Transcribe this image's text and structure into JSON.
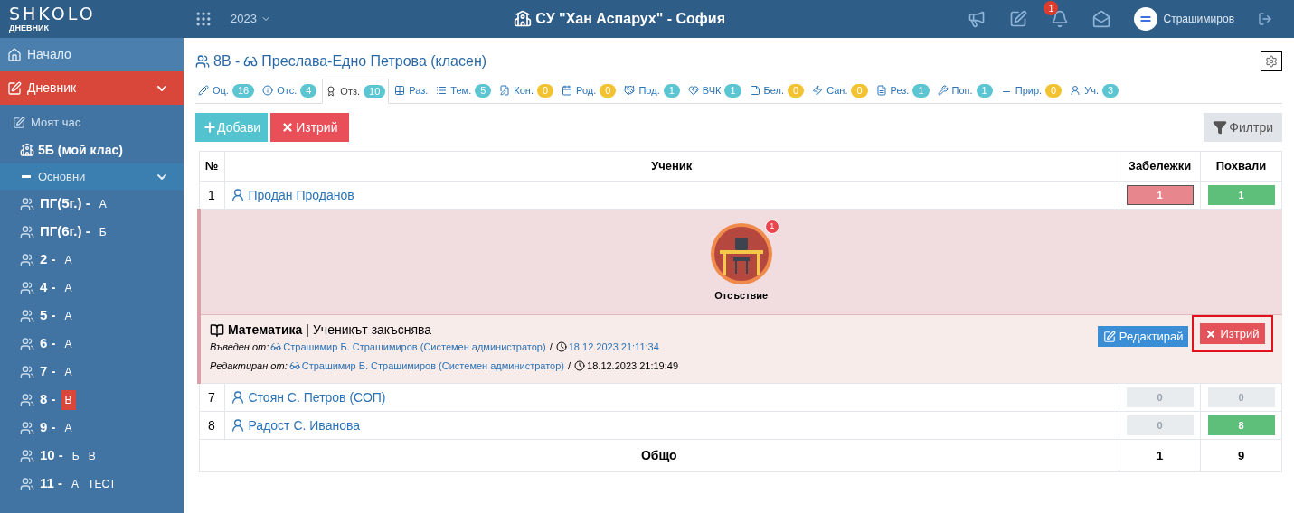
{
  "header": {
    "logo": "SHKOLO",
    "logo_sub": "ДНЕВНИК",
    "year": "2023",
    "school": "СУ \"Хан Аспарух\" - София",
    "notifications": "1",
    "user": "Страшимиров"
  },
  "sidebar": {
    "items": [
      {
        "kind": "main",
        "label": "Начало",
        "selected": false
      },
      {
        "kind": "main",
        "label": "Дневник",
        "selected": true
      },
      {
        "kind": "link",
        "label": "Моят час"
      },
      {
        "kind": "myclass",
        "label": "5Б (мой клас)"
      },
      {
        "kind": "group",
        "label": "Основни",
        "expanded": true
      },
      {
        "kind": "class",
        "label": "ПГ(5г.) -",
        "sections": [
          {
            "text": "А",
            "selected": false
          }
        ]
      },
      {
        "kind": "class",
        "label": "ПГ(6г.) -",
        "sections": [
          {
            "text": "Б",
            "selected": false
          }
        ]
      },
      {
        "kind": "class",
        "label": "2 -",
        "sections": [
          {
            "text": "А",
            "selected": false
          }
        ]
      },
      {
        "kind": "class",
        "label": "4 -",
        "sections": [
          {
            "text": "А",
            "selected": false
          }
        ]
      },
      {
        "kind": "class",
        "label": "5 -",
        "sections": [
          {
            "text": "А",
            "selected": false
          }
        ]
      },
      {
        "kind": "class",
        "label": "6 -",
        "sections": [
          {
            "text": "А",
            "selected": false
          }
        ]
      },
      {
        "kind": "class",
        "label": "7 -",
        "sections": [
          {
            "text": "А",
            "selected": false
          }
        ]
      },
      {
        "kind": "class",
        "label": "8 -",
        "sections": [
          {
            "text": "В",
            "selected": true
          }
        ]
      },
      {
        "kind": "class",
        "label": "9 -",
        "sections": [
          {
            "text": "А",
            "selected": false
          }
        ]
      },
      {
        "kind": "class",
        "label": "10 -",
        "sections": [
          {
            "text": "Б",
            "selected": false
          },
          {
            "text": "В",
            "selected": false
          }
        ]
      },
      {
        "kind": "class",
        "label": "11 -",
        "sections": [
          {
            "text": "А",
            "selected": false
          },
          {
            "text": "ТЕСТ",
            "selected": false
          }
        ]
      }
    ]
  },
  "page": {
    "class_name": "8В -",
    "teacher": "Преслава-Едно Петрова (класен)"
  },
  "tabs": [
    {
      "label": "Оц.",
      "count": "16",
      "color": "#5bc5d1",
      "selected": false
    },
    {
      "label": "Отс.",
      "count": "4",
      "color": "#5bc5d1",
      "selected": false
    },
    {
      "label": "Отз.",
      "count": "10",
      "color": "#5bc5d1",
      "selected": true
    },
    {
      "label": "Раз.",
      "selected": false
    },
    {
      "label": "Тем.",
      "count": "5",
      "color": "#5bc5d1",
      "selected": false
    },
    {
      "label": "Кон.",
      "count": "0",
      "color": "#f2c230",
      "selected": false
    },
    {
      "label": "Род.",
      "count": "0",
      "color": "#f2c230",
      "selected": false
    },
    {
      "label": "Под.",
      "count": "1",
      "color": "#5bc5d1",
      "selected": false
    },
    {
      "label": "ВЧК",
      "count": "1",
      "color": "#5bc5d1",
      "selected": false
    },
    {
      "label": "Бел.",
      "count": "0",
      "color": "#f2c230",
      "selected": false
    },
    {
      "label": "Сан.",
      "count": "0",
      "color": "#f2c230",
      "selected": false
    },
    {
      "label": "Рез.",
      "count": "1",
      "color": "#5bc5d1",
      "selected": false
    },
    {
      "label": "Поп.",
      "count": "1",
      "color": "#5bc5d1",
      "selected": false
    },
    {
      "label": "Прир.",
      "count": "0",
      "color": "#f2c230",
      "selected": false
    },
    {
      "label": "Уч.",
      "count": "3",
      "color": "#5bc5d1",
      "selected": false
    }
  ],
  "toolbar": {
    "add": "Добави",
    "delete": "Изтрий",
    "filters": "Филтри"
  },
  "table": {
    "columns": [
      "№",
      "Ученик",
      "Забележки",
      "Похвали"
    ],
    "rows": [
      {
        "kind": "student",
        "number": "1",
        "name": "Продан Проданов",
        "notes": {
          "value": "1",
          "color": "#e7868d"
        },
        "praises": {
          "value": "1",
          "color": "#5dbf7a"
        }
      },
      {
        "kind": "detail",
        "badge": "1",
        "type": "Отсъствие",
        "subject": "Математика",
        "separator": "|",
        "slash": "/",
        "text": "Ученикът закъснява",
        "entered_label": "Въведен от:",
        "entered_by": "Страшимир Б. Страшимиров (Системен администратор)",
        "entered_at": "18.12.2023 21:11:34",
        "edited_label": "Редактиран от:",
        "edited_by": "Страшимир Б. Страшимиров (Системен администратор)",
        "edited_at": "18.12.2023 21:19:49",
        "edit": "Редактирай",
        "delete": "Изтрий",
        "delete_highlighted": true
      },
      {
        "kind": "student",
        "number": "7",
        "name": "Стоян С. Петров (СОП)",
        "notes": {
          "value": "0",
          "color": "#e9ecef"
        },
        "praises": {
          "value": "0",
          "color": "#e9ecef"
        }
      },
      {
        "kind": "student",
        "number": "8",
        "name": "Радост С. Иванова",
        "notes": {
          "value": "0",
          "color": "#e9ecef"
        },
        "praises": {
          "value": "8",
          "color": "#5dbf7a"
        }
      }
    ],
    "total": {
      "label": "Общо",
      "notes": "1",
      "praises": "9"
    }
  }
}
